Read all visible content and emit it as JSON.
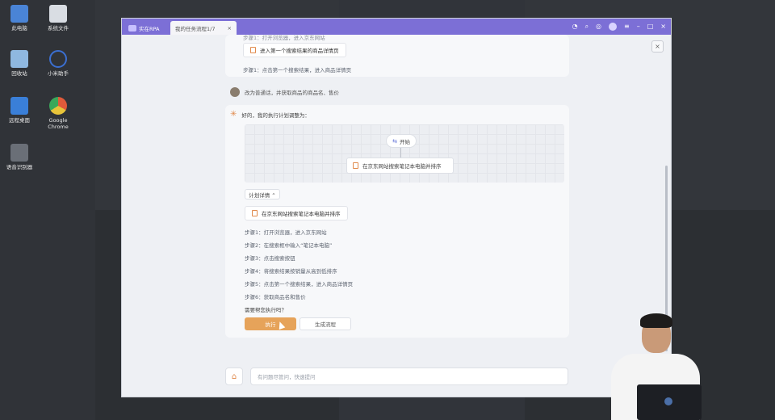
{
  "desktop": {
    "icons": [
      {
        "label": "此电脑",
        "icon": "computer-icon",
        "color": "#4a84d6"
      },
      {
        "label": "系统文件",
        "icon": "file-icon",
        "color": "#d9dde3"
      },
      {
        "label": "回收站",
        "icon": "recycle-bin-icon",
        "color": "#8fb8e0"
      },
      {
        "label": "小米助手",
        "icon": "assistant-icon",
        "color": "#3b6fd1"
      },
      {
        "label": "远程桌面",
        "icon": "remote-desktop-icon",
        "color": "#3a7fd8"
      },
      {
        "label": "Google Chrome",
        "icon": "chrome-icon",
        "color": "#e8a33a"
      },
      {
        "label": "语音识别器",
        "icon": "keyboard-icon",
        "color": "#6a6f77"
      }
    ]
  },
  "window": {
    "tabs": [
      {
        "label": "实在RPA",
        "icon": "rpa-logo-icon"
      },
      {
        "label": "我的任务流程1/7",
        "close": "×"
      }
    ],
    "toolbar_icons": [
      "help-icon",
      "search-icon",
      "notification-icon",
      "user-avatar-icon",
      "menu-icon",
      "minimize-icon",
      "maximize-icon",
      "close-icon"
    ],
    "panel_close": "×",
    "accent_color": "#7c6fd6"
  },
  "chat": {
    "prev": {
      "top_cut_text": "步骤1：打开浏览器，进入京东网站",
      "task_label": "进入第一个搜索结果的商品详情页",
      "step_label": "步骤1：点击第一个搜索结果，进入商品详情页"
    },
    "user_message": "改为普通话，并获取商品的商品名、售价",
    "bot": {
      "intro": "好的，我的执行计划调整为：",
      "flow": {
        "start_label": "开始",
        "task_label": "在京东网站搜索笔记本电脑并排序"
      },
      "plan_toggle": "计划详情 ⌃",
      "task_card": "在京东网站搜索笔记本电脑并排序",
      "steps": [
        "步骤1：打开浏览器，进入京东网站",
        "步骤2：在搜索框中输入“笔记本电脑”",
        "步骤3：点击搜索按钮",
        "步骤4：将搜索结果按销量从高到低排序",
        "步骤5：点击第一个搜索结果，进入商品详情页",
        "步骤6：获取商品名和售价"
      ],
      "question": "需要帮您执行吗？",
      "run_button": "执行",
      "generate_button": "生成流程"
    },
    "input": {
      "placeholder": "有问题尽管问，快速提问"
    }
  }
}
